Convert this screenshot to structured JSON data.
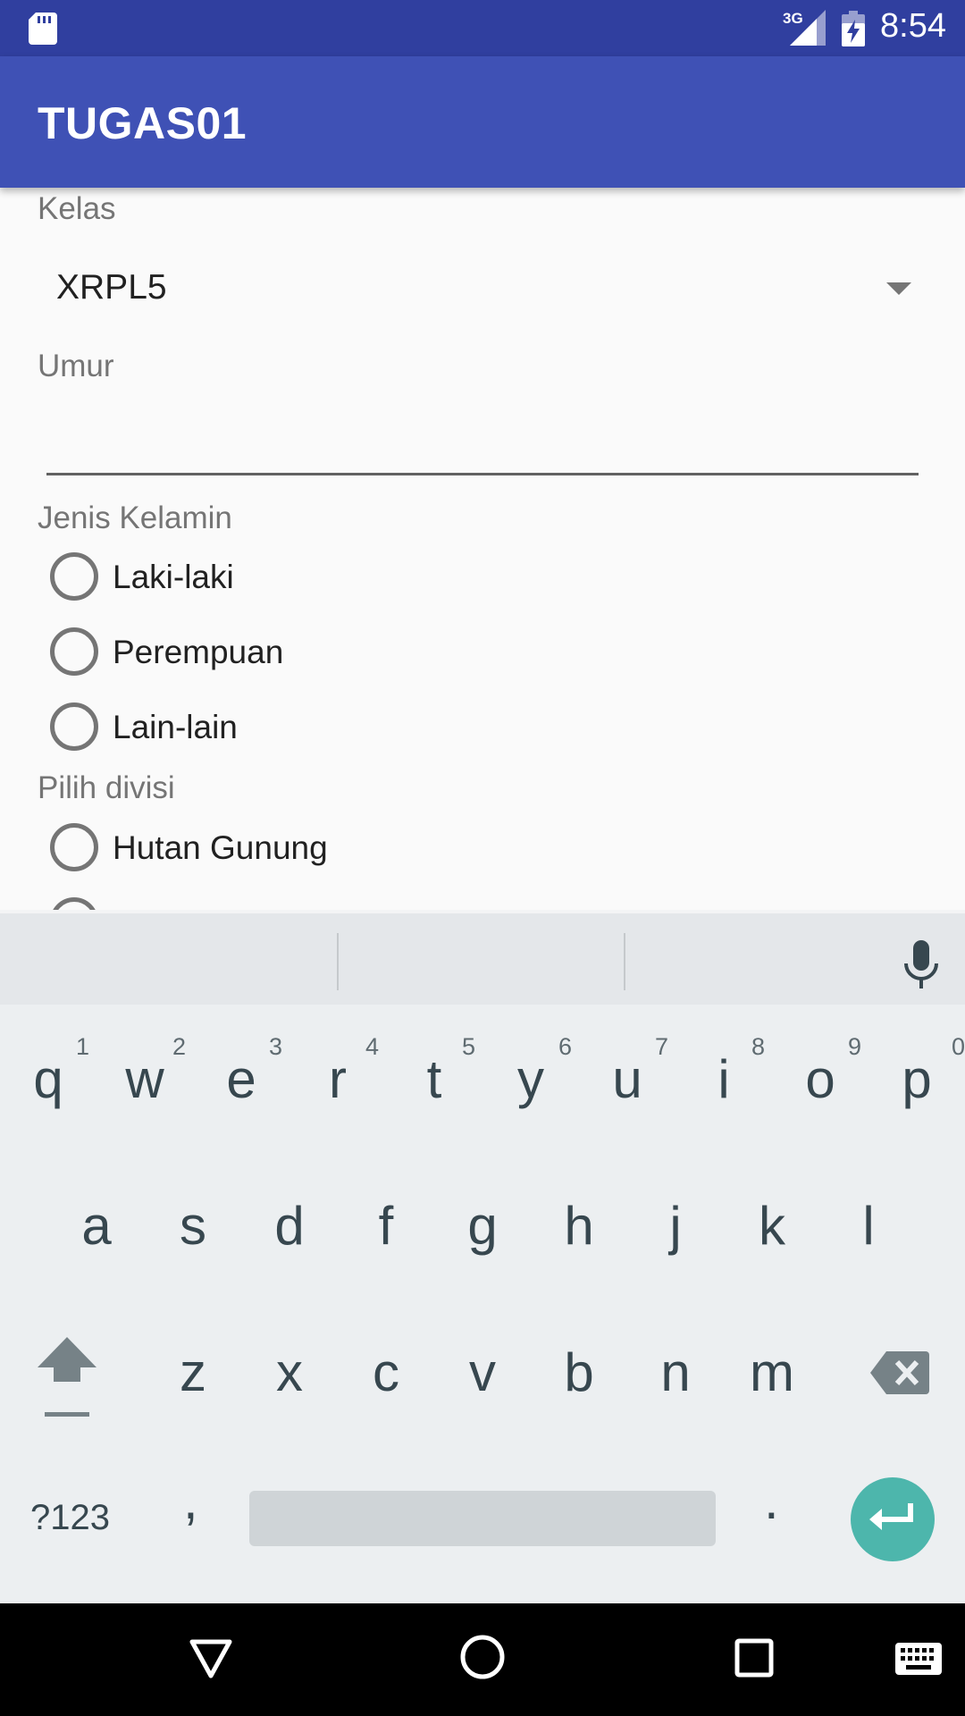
{
  "status_bar": {
    "network_label": "3G",
    "time": "8:54",
    "icons": [
      "sd-card-icon",
      "signal-icon",
      "battery-charging-icon"
    ]
  },
  "app_bar": {
    "title": "TUGAS01"
  },
  "form": {
    "kelas_label": "Kelas",
    "kelas_value": "XRPL5",
    "umur_label": "Umur",
    "umur_value": "",
    "gender_label": "Jenis Kelamin",
    "gender_options": [
      "Laki-laki",
      "Perempuan",
      "Lain-lain"
    ],
    "divisi_label": "Pilih divisi",
    "divisi_options": [
      "Hutan Gunung"
    ]
  },
  "keyboard": {
    "row1": [
      "q",
      "w",
      "e",
      "r",
      "t",
      "y",
      "u",
      "i",
      "o",
      "p"
    ],
    "row1_hints": [
      "1",
      "2",
      "3",
      "4",
      "5",
      "6",
      "7",
      "8",
      "9",
      "0"
    ],
    "row2": [
      "a",
      "s",
      "d",
      "f",
      "g",
      "h",
      "j",
      "k",
      "l"
    ],
    "row3": [
      "z",
      "x",
      "c",
      "v",
      "b",
      "n",
      "m"
    ],
    "symbols_label": "?123",
    "comma": ",",
    "period": ".",
    "icons": [
      "mic-icon",
      "shift-icon",
      "backspace-icon",
      "enter-icon"
    ],
    "accent_color": "#4db6ac"
  },
  "nav_bar": {
    "icons": [
      "back-icon",
      "home-icon",
      "recents-icon",
      "keyboard-switch-icon"
    ]
  },
  "colors": {
    "primary": "#3f51b5",
    "primary_dark": "#303f9f"
  }
}
